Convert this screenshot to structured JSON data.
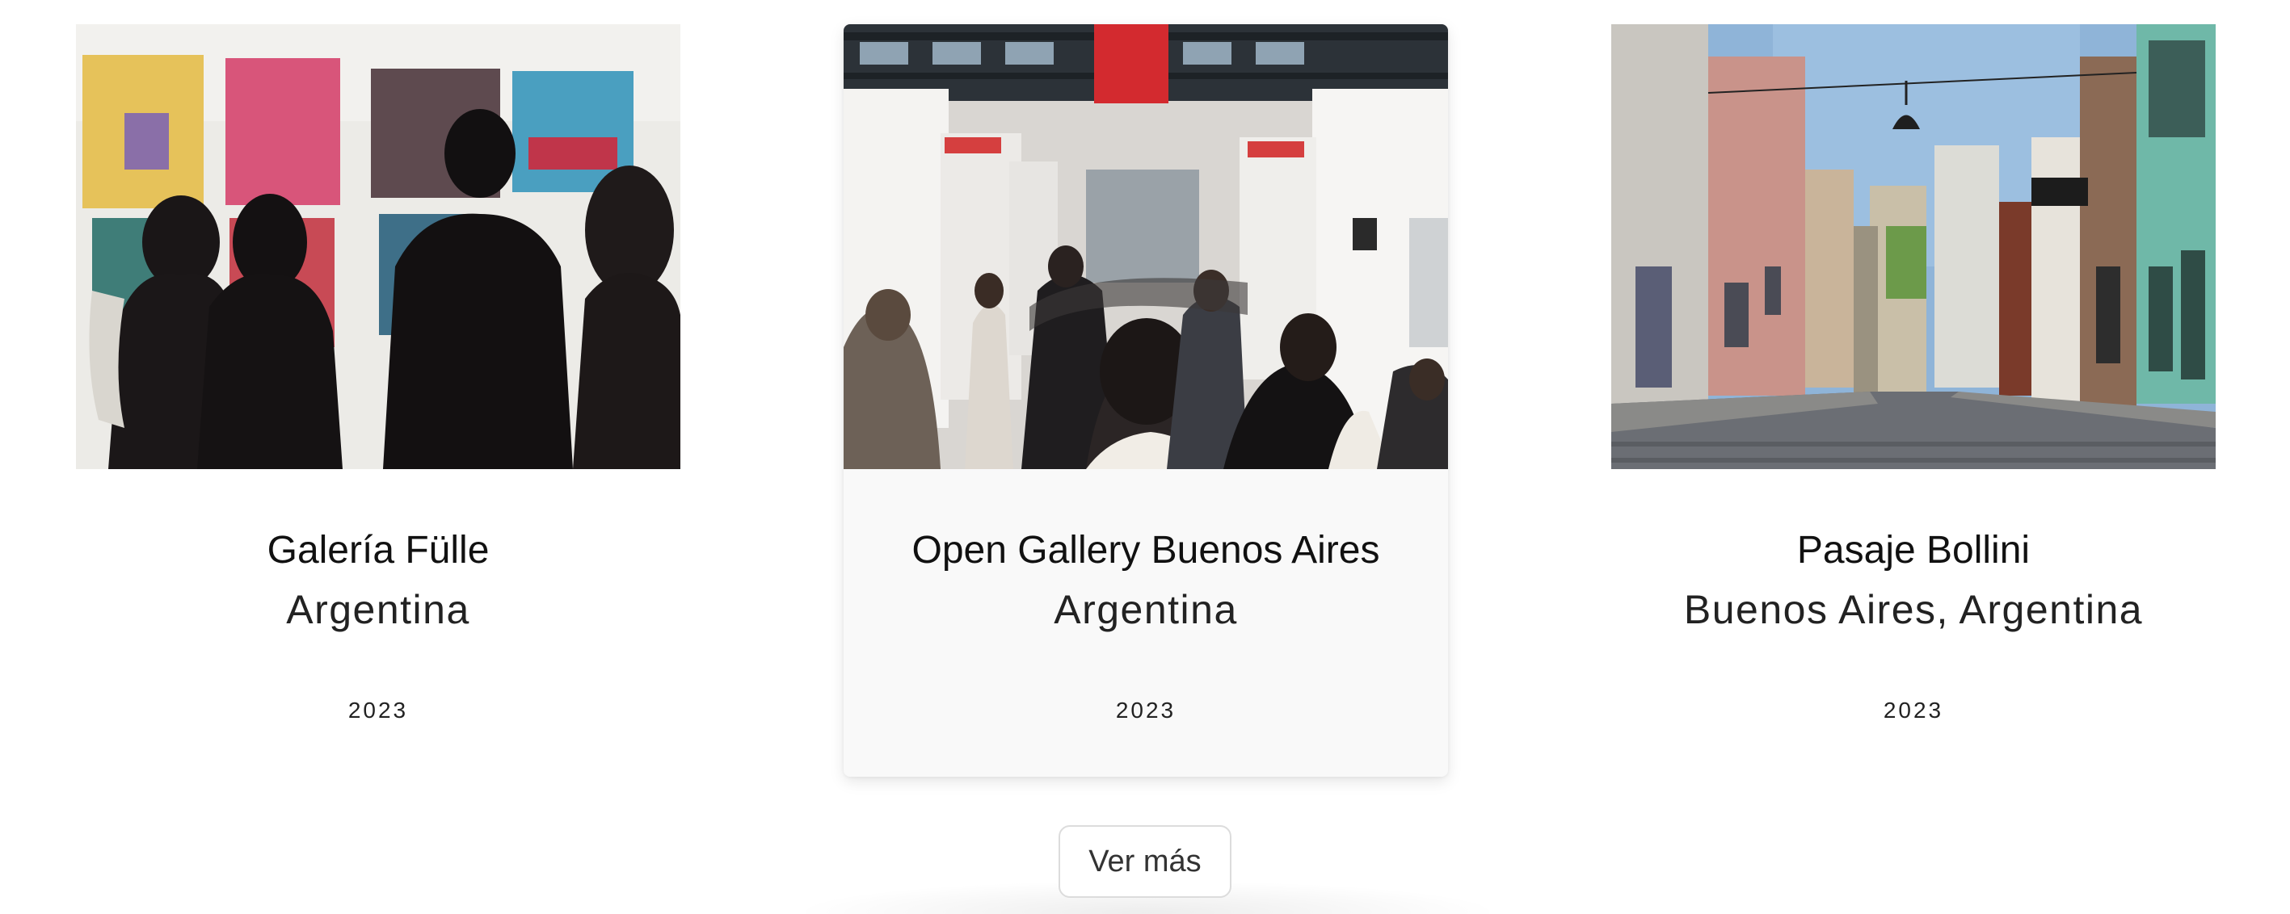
{
  "cards": [
    {
      "title": "Galería Fülle",
      "location": "Argentina",
      "year": "2023",
      "image_subject": "visitors-viewing-illustrations-at-gallery"
    },
    {
      "title": "Open Gallery Buenos Aires",
      "location": "Argentina",
      "year": "2023",
      "image_subject": "crowded-art-fair-hall"
    },
    {
      "title": "Pasaje Bollini",
      "location": "Buenos Aires, Argentina",
      "year": "2023",
      "image_subject": "cobblestone-street-with-colorful-facades"
    }
  ],
  "more_button": {
    "label": "Ver más"
  },
  "colors": {
    "highlight_card_background": "#f9f9f9",
    "text": "#111111",
    "button_border": "#dcdcdc"
  }
}
